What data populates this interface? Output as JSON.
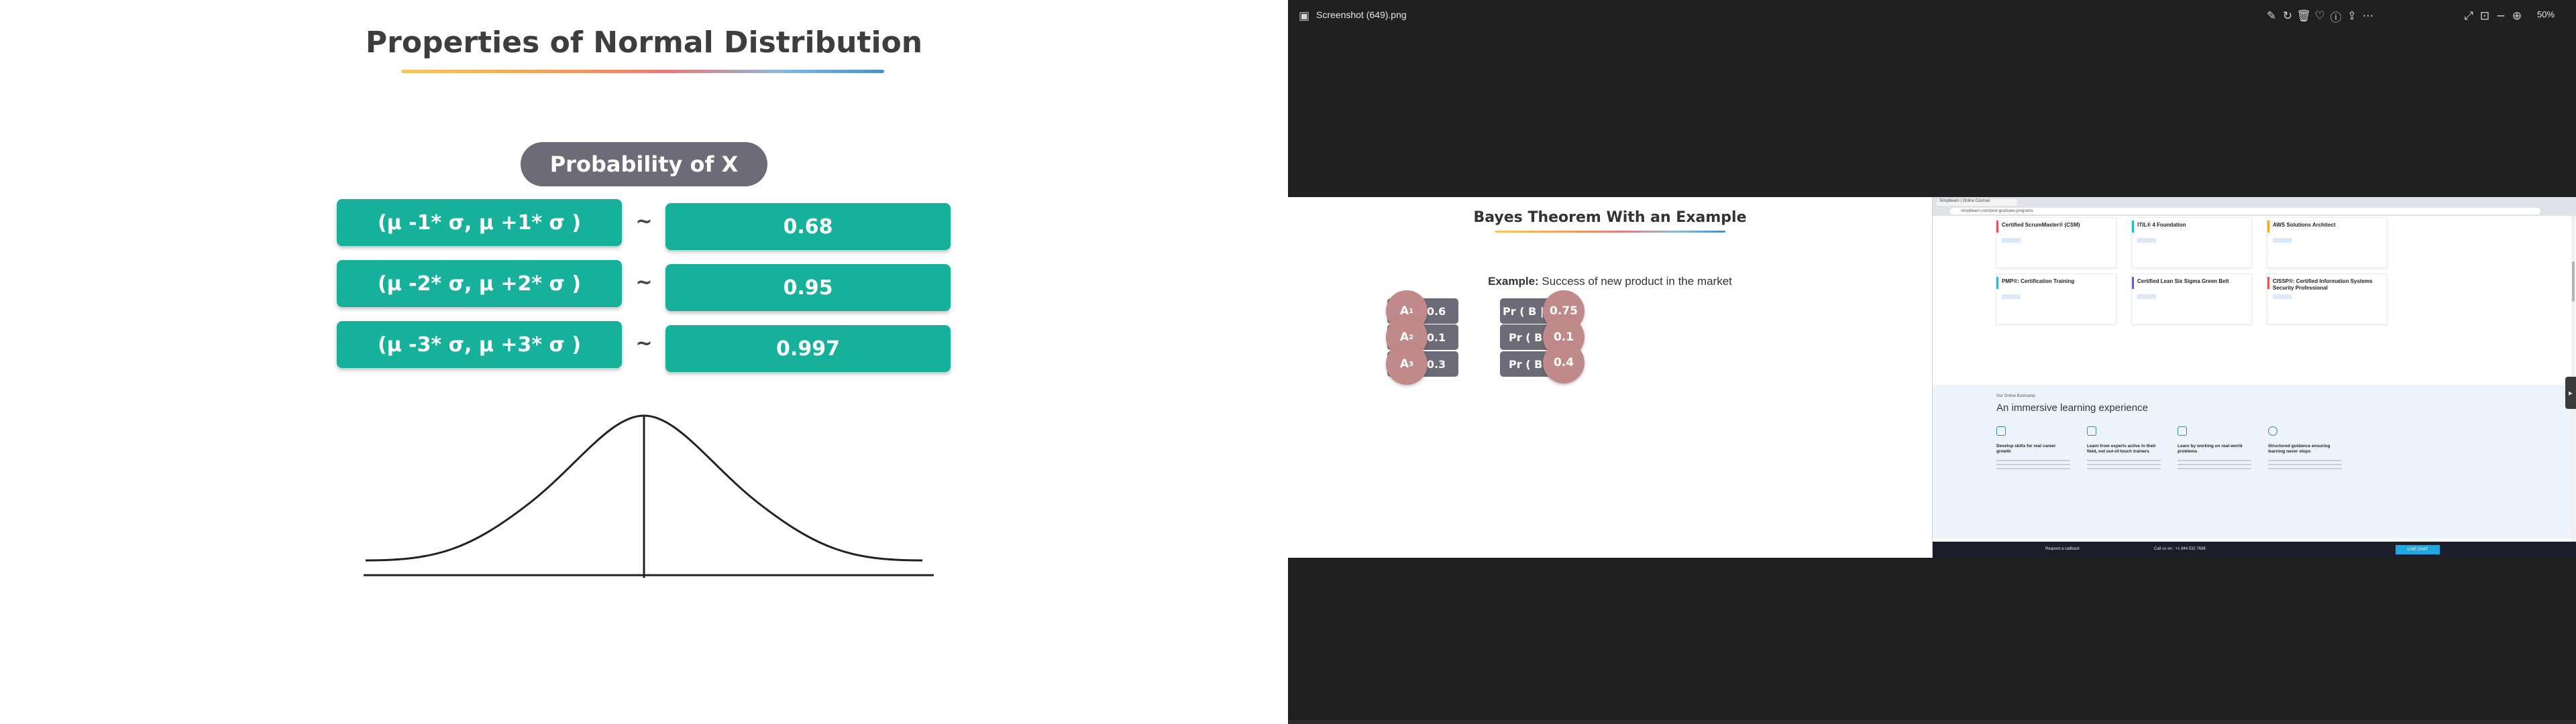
{
  "left_slide": {
    "title": "Properties of Normal Distribution",
    "header_pill": "Probability of X",
    "rows": [
      {
        "range": "(μ -1* σ, μ +1* σ )",
        "sep": "~",
        "value": "0.68"
      },
      {
        "range": "(μ -2* σ, μ +2* σ )",
        "sep": "~",
        "value": "0.95"
      },
      {
        "range": "(μ -3* σ, μ +3* σ )",
        "sep": "~",
        "value": "0.997"
      }
    ]
  },
  "viewer": {
    "filename": "Screenshot (649).png",
    "zoom": "50%",
    "toolbar_icons": [
      "edit-image-icon",
      "rotate-icon",
      "delete-icon",
      "favorite-icon",
      "info-icon",
      "share-icon",
      "more-icon"
    ],
    "right_icons": [
      "fullscreen-icon",
      "fit-icon",
      "zoom-out-icon",
      "zoom-in-icon"
    ]
  },
  "bayes_slide": {
    "title": "Bayes Theorem With an Example",
    "example_label": "Example:",
    "example_text": "Success of new product in the market",
    "left_rows": [
      {
        "circle": "A",
        "sub": "1",
        "value": "0.6"
      },
      {
        "circle": "A",
        "sub": "2",
        "value": "0.1"
      },
      {
        "circle": "A",
        "sub": "3",
        "value": "0.3"
      }
    ],
    "right_rows": [
      {
        "label": "Pr ( B | A",
        "sub": "1",
        "close": " )",
        "value": "0.75"
      },
      {
        "label": "Pr ( B | A",
        "sub": "2",
        "close": " )",
        "value": "0.1"
      },
      {
        "label": "Pr ( B | A",
        "sub": "3",
        "close": " )",
        "value": "0.4"
      }
    ]
  },
  "webpage": {
    "tab": "Simplilearn | Online Courses",
    "url": "simplilearn.com/post-graduate-programs",
    "cards": [
      {
        "title": "Certified ScrumMaster® (CSM)",
        "color": "#e8515a"
      },
      {
        "title": "ITIL® 4 Foundation",
        "color": "#2fb7c9"
      },
      {
        "title": "AWS Solutions Architect",
        "color": "#f5a623"
      },
      {
        "title": "PMP®: Certification Training",
        "color": "#2fb7c9"
      },
      {
        "title": "Certified Lean Six Sigma Green Belt",
        "color": "#6a5acd"
      },
      {
        "title": "CISSP®: Certified Information Systems Security Professional",
        "color": "#e8515a"
      }
    ],
    "section_small": "Our Online Bootcamp",
    "section_head": "An immersive learning experience",
    "features": [
      {
        "title": "Develop skills for real career growth"
      },
      {
        "title": "Learn from experts active in their field, not out-of-touch trainers"
      },
      {
        "title": "Learn by working on real-world problems"
      },
      {
        "title": "Structured guidance ensuring learning never stops"
      }
    ],
    "footer": {
      "callback": "Request a callback",
      "call": "Call us on : +1 844 532 7688",
      "cta": "LIVE CHAT"
    }
  }
}
